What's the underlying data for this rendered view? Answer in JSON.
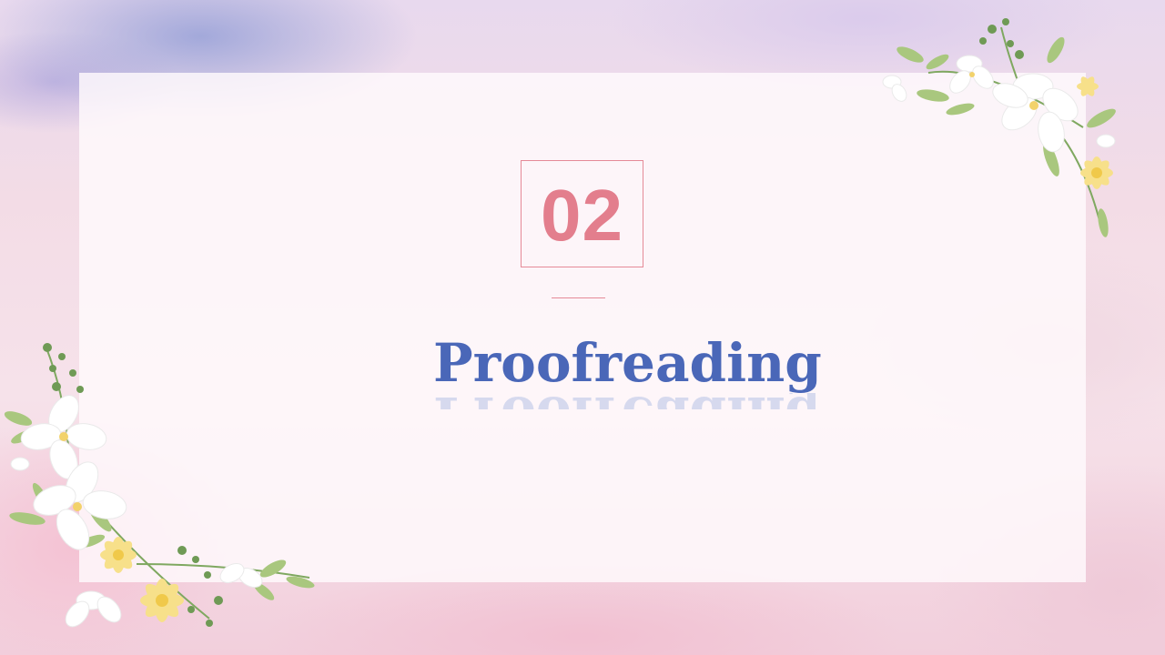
{
  "slide": {
    "number": "02",
    "title": "Proofreading"
  },
  "colors": {
    "accent_pink": "#e37e8d",
    "title_blue": "#4a67b8"
  },
  "decorations": {
    "top_right": "floral-corner-icon",
    "bottom_left": "floral-corner-icon"
  }
}
